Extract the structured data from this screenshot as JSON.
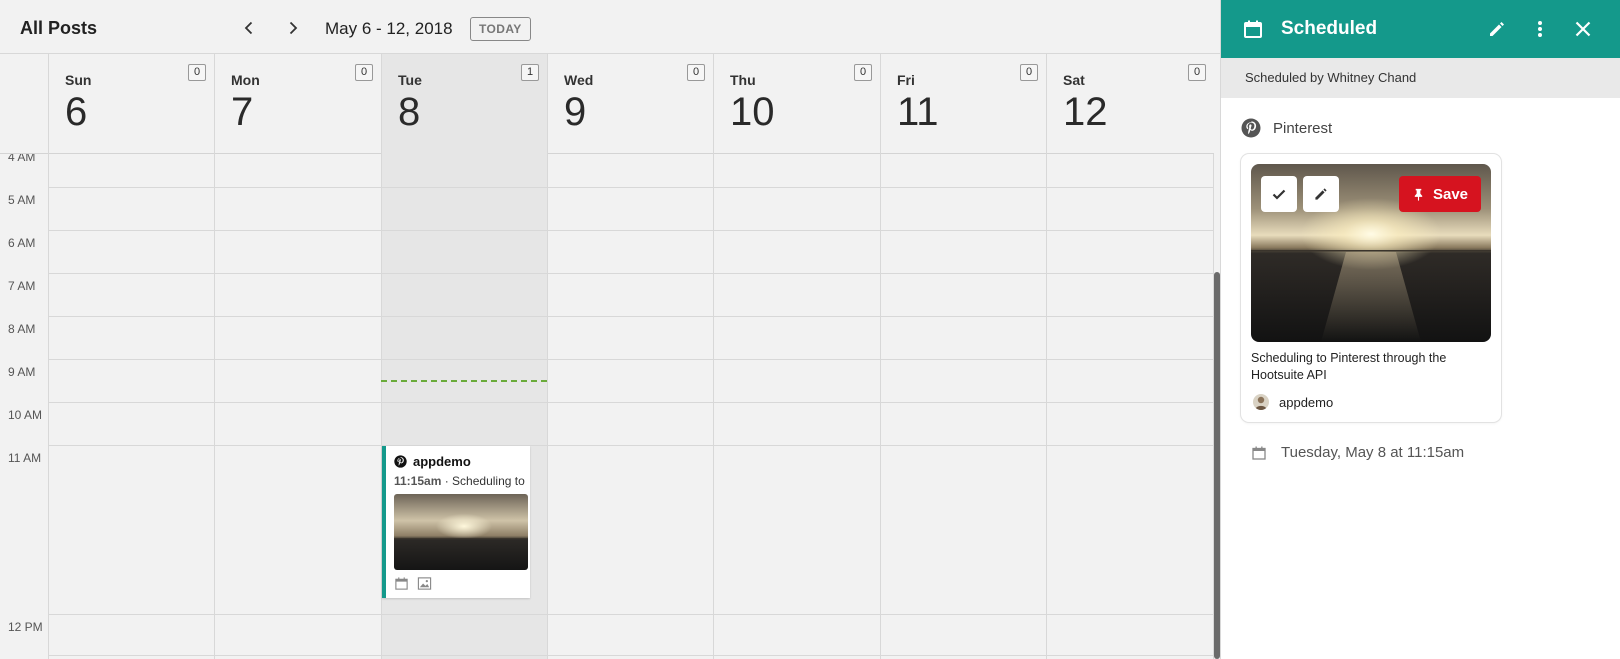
{
  "topbar": {
    "title": "All Posts",
    "range": "May 6 - 12, 2018",
    "today_label": "TODAY"
  },
  "days": [
    {
      "name": "Sun",
      "num": "6",
      "count": "0"
    },
    {
      "name": "Mon",
      "num": "7",
      "count": "0"
    },
    {
      "name": "Tue",
      "num": "8",
      "count": "1"
    },
    {
      "name": "Wed",
      "num": "9",
      "count": "0"
    },
    {
      "name": "Thu",
      "num": "10",
      "count": "0"
    },
    {
      "name": "Fri",
      "num": "11",
      "count": "0"
    },
    {
      "name": "Sat",
      "num": "12",
      "count": "0"
    }
  ],
  "hours": [
    "4 AM",
    "5 AM",
    "6 AM",
    "7 AM",
    "8 AM",
    "9 AM",
    "10 AM",
    "11 AM",
    "12 PM"
  ],
  "post": {
    "account": "appdemo",
    "time": "11:15am",
    "text": " · Scheduling to Pinterest through the Hootsuite API"
  },
  "panel": {
    "title": "Scheduled",
    "scheduled_by": "Scheduled by Whitney Chand",
    "network": "Pinterest",
    "save_label": "Save",
    "description": "Scheduling to Pinterest through the Hootsuite API",
    "author": "appdemo",
    "when": "Tuesday, May 8 at 11:15am"
  },
  "colors": {
    "accent": "#14998b",
    "pinterest_red": "#d6131f",
    "now_line": "#6aab3a"
  },
  "icons": {
    "prev": "chevron-left-icon",
    "next": "chevron-right-icon",
    "calendar": "calendar-icon",
    "edit": "pencil-icon",
    "more": "more-vertical-icon",
    "close": "close-icon",
    "network": "pinterest-icon",
    "approve": "check-icon",
    "pin": "pushpin-icon",
    "image": "image-icon"
  }
}
